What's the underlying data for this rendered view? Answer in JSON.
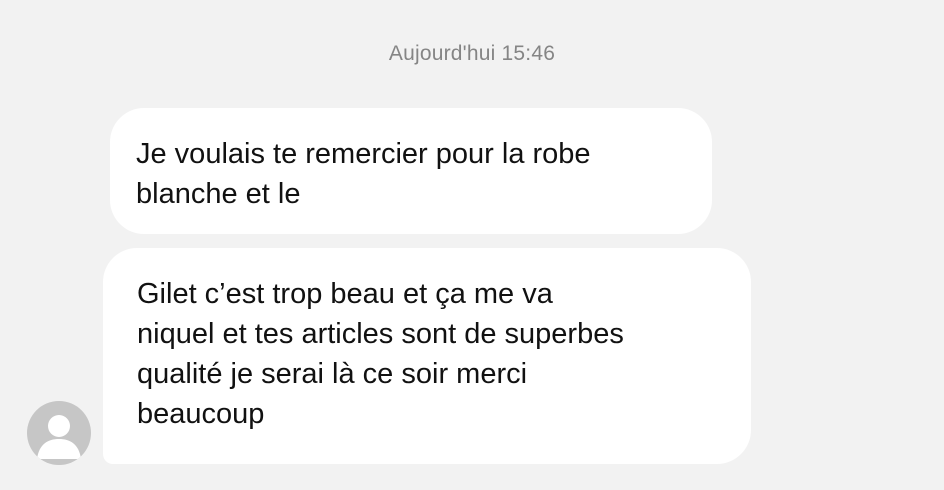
{
  "conversation": {
    "timestamp": "Aujourd'hui 15:46",
    "messages": [
      {
        "lines": [
          "Je voulais te remercier pour la robe",
          "blanche et le"
        ]
      },
      {
        "lines": [
          "Gilet c’est trop beau et ça me va",
          "niquel et tes articles sont de superbes",
          "qualité je serai là ce soir merci",
          "beaucoup"
        ]
      }
    ]
  },
  "contact": {
    "avatar_icon": "person-silhouette-icon"
  },
  "colors": {
    "background": "#f2f2f2",
    "bubble": "#ffffff",
    "timestamp_text": "#858585",
    "avatar": "#c6c6c6"
  }
}
